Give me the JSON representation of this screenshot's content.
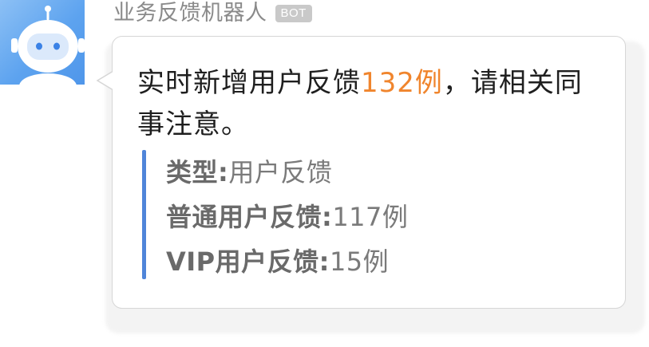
{
  "sender": {
    "name": "业务反馈机器人",
    "badge": "BOT"
  },
  "message": {
    "prefix": "实时新增用户反馈",
    "count": "132例",
    "suffix": "，请相关同事注意。"
  },
  "details": [
    {
      "label": "类型",
      "sep": ":",
      "value": "用户反馈"
    },
    {
      "label": "普通用户反馈",
      "sep": ":",
      "value": "117例"
    },
    {
      "label": "VIP用户反馈",
      "sep": ":",
      "value": "15例"
    }
  ],
  "colors": {
    "highlight": "#f0852d",
    "quote_bar": "#4f85d9",
    "avatar_bg": "#5da3ef"
  },
  "icons": {
    "avatar": "robot-icon"
  }
}
